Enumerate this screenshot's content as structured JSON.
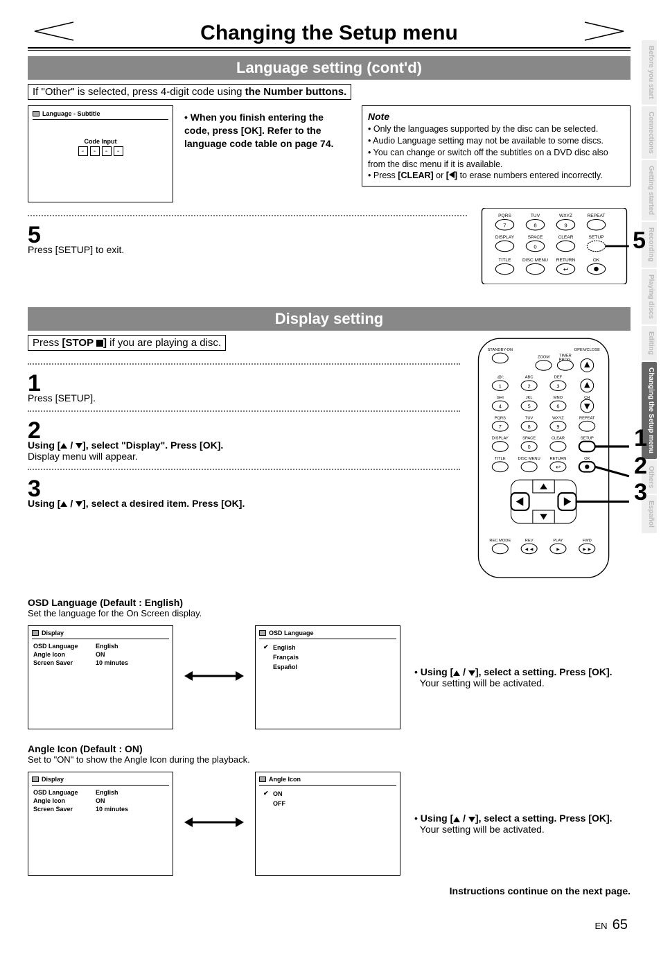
{
  "sideTabs": [
    "Before you start",
    "Connections",
    "Getting started",
    "Recording",
    "Playing discs",
    "Editing",
    "Changing the Setup menu",
    "Others",
    "Español"
  ],
  "sideTabActive": "Changing the Setup menu",
  "mainTitle": "Changing the Setup menu",
  "band1": "Language setting (cont'd)",
  "instr1_pre": "If \"Other\" is selected, press 4-digit code using ",
  "instr1_bold": "the Number buttons.",
  "osd1": {
    "title": "Language - Subtitle",
    "label": "Code Input",
    "dash": "-"
  },
  "whenFinish": {
    "l1": "When you finish entering the code, press [OK]. Refer to the language code table on page 74."
  },
  "note": {
    "title": "Note",
    "b1": "Only the languages supported by the disc can be selected.",
    "b2": "Audio Language setting may not be available to some discs.",
    "b3": "You can change or switch off the subtitles on a DVD disc also from the disc menu if it is available.",
    "b4_pre": "Press ",
    "b4_c": "[CLEAR]",
    "b4_or": " or ",
    "b4_left": "[",
    "b4_left2": "]",
    "b4_post": " to erase numbers entered incorrectly."
  },
  "step5": {
    "num": "5",
    "text": "Press [SETUP] to exit."
  },
  "remote5": {
    "row": [
      "PQRS",
      "TUV",
      "WXYZ",
      "REPEAT"
    ],
    "nums": [
      "7",
      "8",
      "9"
    ],
    "row2": [
      "DISPLAY",
      "SPACE",
      "CLEAR",
      "SETUP"
    ],
    "zero": "0",
    "row3": [
      "TITLE",
      "DISC MENU",
      "RETURN",
      "OK"
    ],
    "callout": "5"
  },
  "band2": "Display setting",
  "instr2_pre": "Press ",
  "instr2_b": "[STOP ",
  "instr2_b2": "]",
  "instr2_post": " if you are playing a disc.",
  "step1": {
    "num": "1",
    "text": "Press [SETUP]."
  },
  "step2": {
    "num": "2",
    "bold": "Using [",
    "bold2": " / ",
    "bold3": "], select \"Display\". Press [OK].",
    "line2": "Display menu will appear."
  },
  "step3": {
    "num": "3",
    "bold": "Using [",
    "bold2": " / ",
    "bold3": "], select a desired item. Press [OK]."
  },
  "bigRemote": {
    "top": [
      "STANDBY-ON",
      "",
      "",
      "OPEN/CLOSE"
    ],
    "r1": [
      "",
      "ZOOM",
      "TIMER PROG.",
      ""
    ],
    "np_row_labels": [
      ".@/:",
      "ABC",
      "DEF",
      ""
    ],
    "np_row_labels2": [
      "GHI",
      "JKL",
      "MNO",
      "CH"
    ],
    "np_row_labels3": [
      "PQRS",
      "TUV",
      "WXYZ",
      "REPEAT"
    ],
    "nums": [
      "1",
      "2",
      "3"
    ],
    "nums2": [
      "4",
      "5",
      "6"
    ],
    "nums3": [
      "7",
      "8",
      "9"
    ],
    "r4": [
      "DISPLAY",
      "SPACE",
      "CLEAR",
      "SETUP"
    ],
    "zero": "0",
    "r5": [
      "TITLE",
      "DISC MENU",
      "RETURN",
      "OK"
    ],
    "bot": [
      "REC MODE",
      "REV",
      "PLAY",
      "FWD"
    ],
    "c1": "1",
    "c2": "2",
    "c3": "3"
  },
  "osdL": {
    "head": "OSD Language (Default : English)",
    "desc": "Set the language for the On Screen display."
  },
  "displayBox": {
    "title": "Display",
    "rows": [
      {
        "k": "OSD Language",
        "v": "English"
      },
      {
        "k": "Angle Icon",
        "v": "ON"
      },
      {
        "k": "Screen Saver",
        "v": "10 minutes"
      }
    ]
  },
  "osdLangBox": {
    "title": "OSD Language",
    "opts": [
      "English",
      "Français",
      "Español"
    ],
    "checked": "English"
  },
  "selectSetting": {
    "bold": "Using [",
    "bold2": " / ",
    "bold3": "], select a setting. Press [OK].",
    "line2": "Your setting will be activated."
  },
  "angle": {
    "head": "Angle Icon (Default : ON)",
    "desc": "Set to \"ON\" to show the Angle Icon during the playback."
  },
  "angleBox": {
    "title": "Angle Icon",
    "opts": [
      "ON",
      "OFF"
    ],
    "checked": "ON"
  },
  "continue": "Instructions continue on the next page.",
  "footer": {
    "en": "EN",
    "page": "65"
  }
}
